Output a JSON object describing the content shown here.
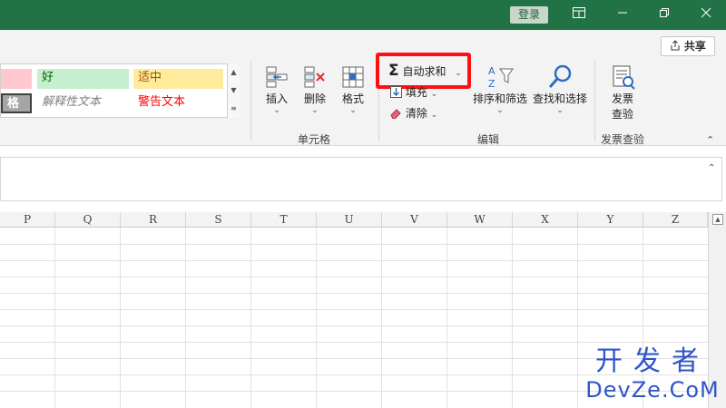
{
  "titlebar": {
    "login_label": "登录",
    "controls": [
      "restore-ribbon",
      "minimize",
      "restore",
      "close"
    ]
  },
  "share": {
    "label": "共享"
  },
  "styles_gallery": {
    "row1": [
      {
        "label": "",
        "bg": "#ffc7ce",
        "color": "#9c0006"
      },
      {
        "label": "好",
        "bg": "#c6efce",
        "color": "#006100"
      },
      {
        "label": "适中",
        "bg": "#ffeb9c",
        "color": "#9c5700"
      }
    ],
    "row2": [
      {
        "label": "格",
        "bg": "#a5a5a5",
        "color": "#ffffff"
      },
      {
        "label": "解释性文本",
        "bg": "#ffffff",
        "color": "#7f7f7f"
      },
      {
        "label": "警告文本",
        "bg": "#ffffff",
        "color": "#ff0000"
      }
    ]
  },
  "cells_group": {
    "label": "单元格",
    "insert": "插入",
    "delete": "删除",
    "format": "格式"
  },
  "editing_group": {
    "label": "编辑",
    "autosum": "自动求和",
    "fill": "填充",
    "clear": "清除",
    "sort_filter": "排序和筛选",
    "find_select": "查找和选择"
  },
  "invoice_group": {
    "label": "发票查验",
    "button_line1": "发票",
    "button_line2": "查验"
  },
  "columns": [
    "P",
    "Q",
    "R",
    "S",
    "T",
    "U",
    "V",
    "W",
    "X",
    "Y",
    "Z"
  ],
  "watermark": {
    "line1": "开发者",
    "line2": "DevZe.CoM"
  },
  "colors": {
    "title_bar": "#217346",
    "highlight": "#ff1010",
    "watermark": "#2f55c9"
  }
}
